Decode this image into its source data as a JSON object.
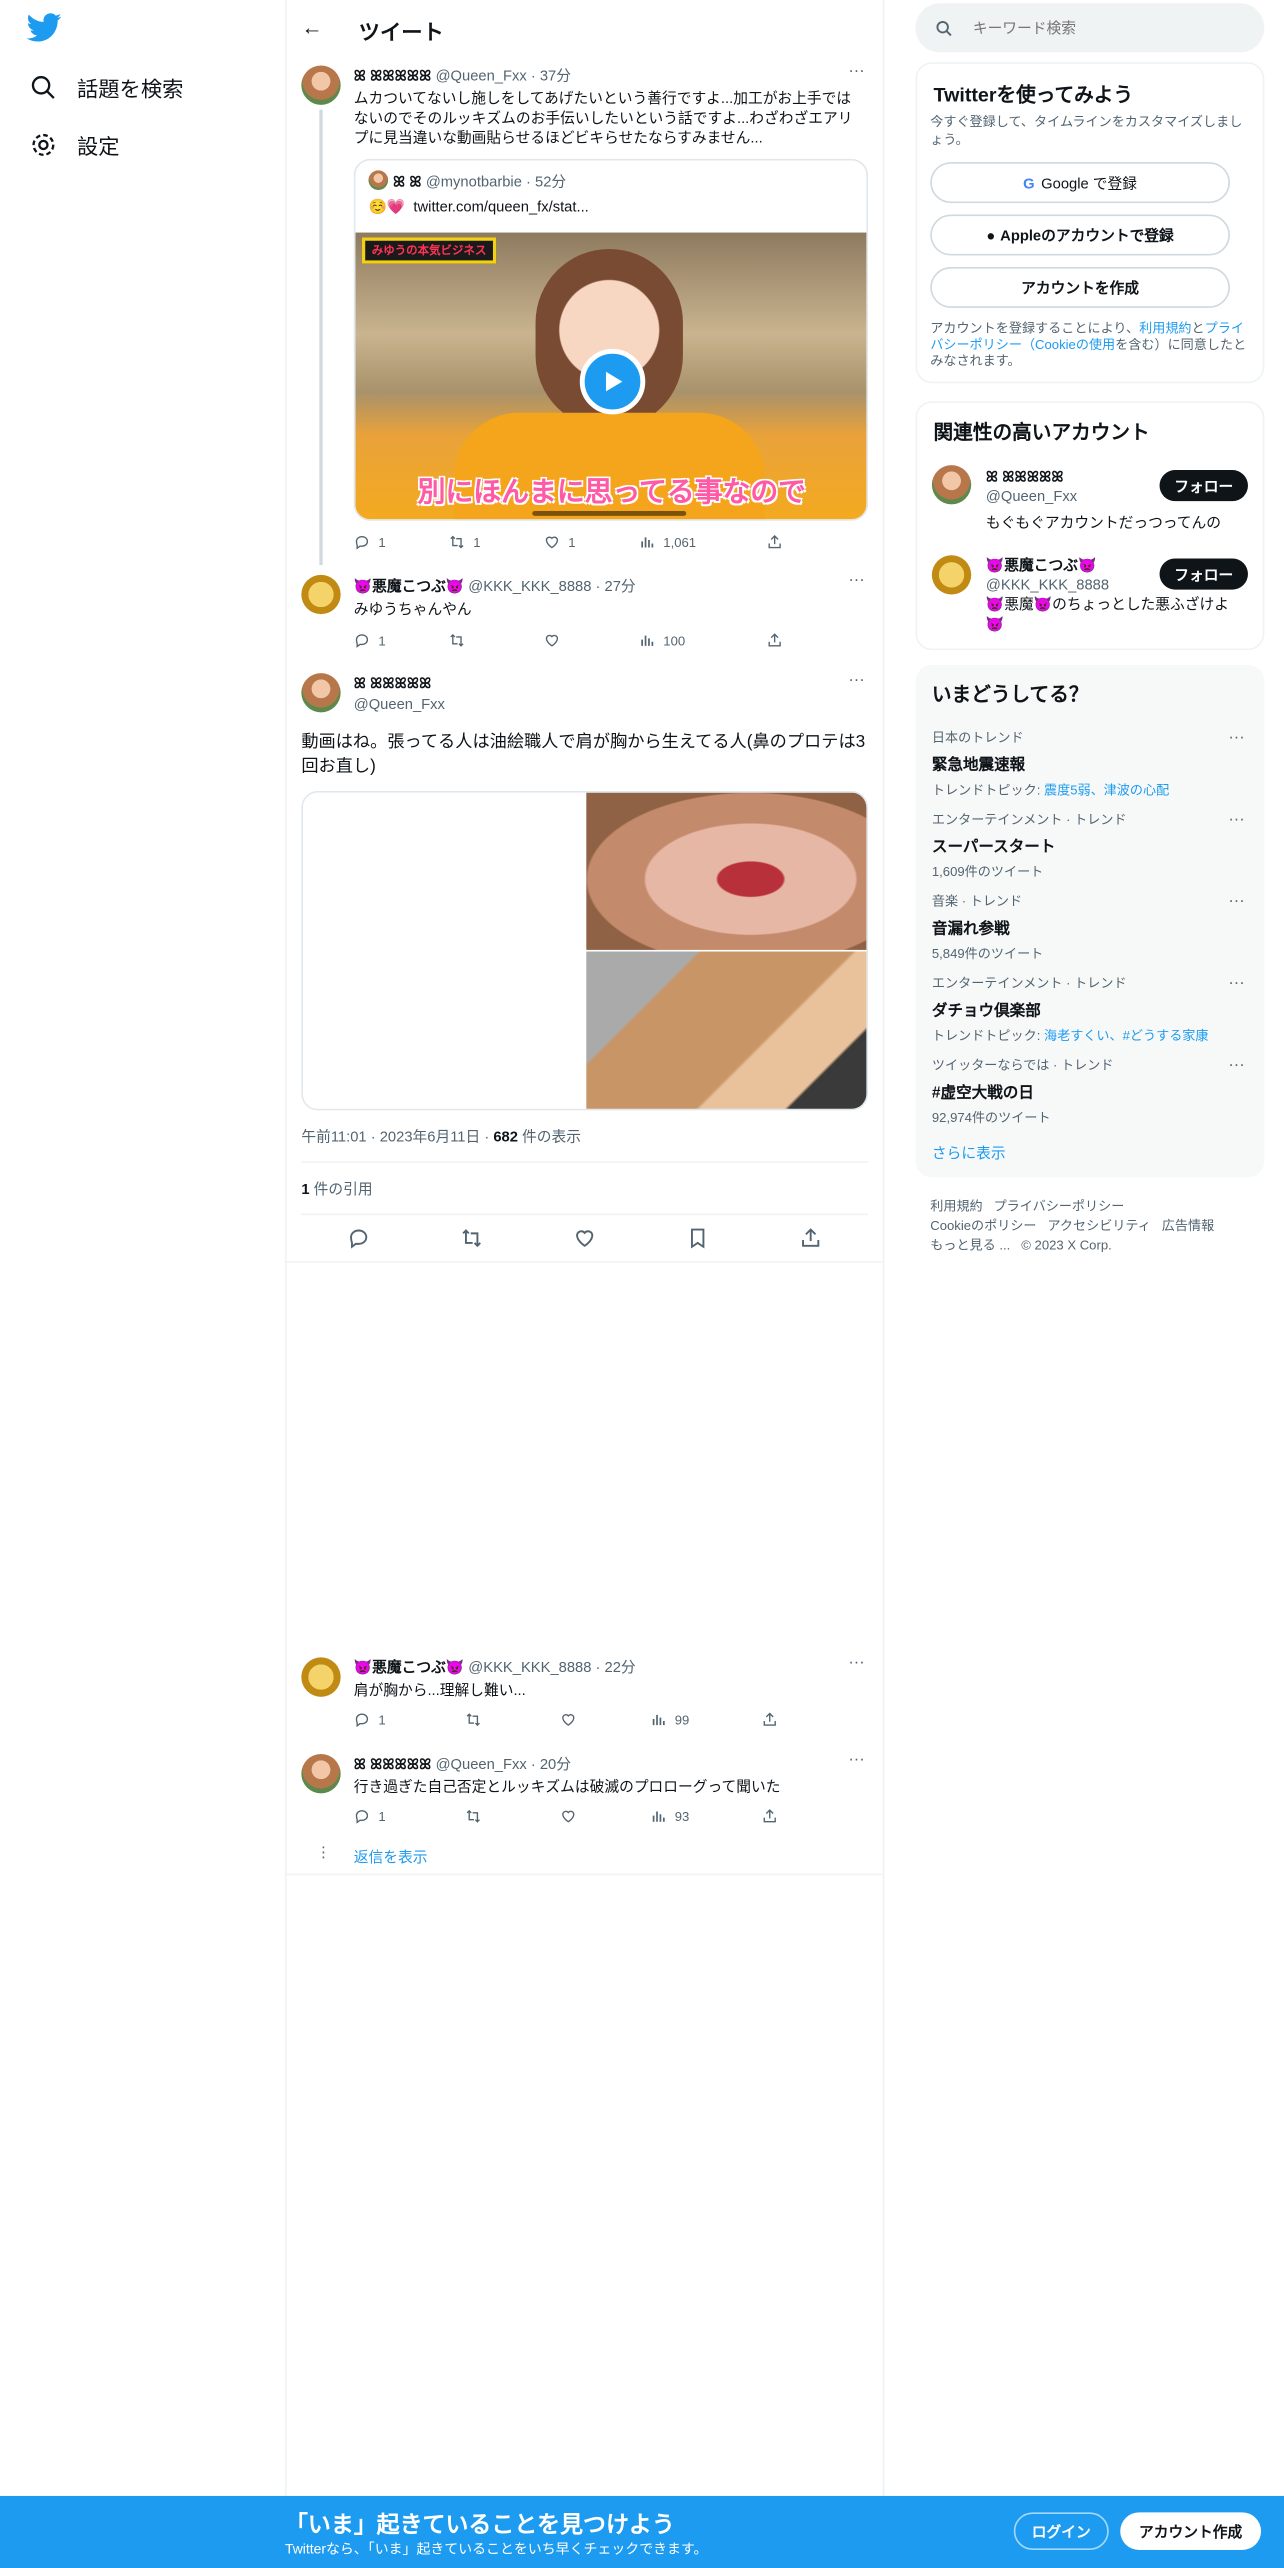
{
  "colors": {
    "accent": "#1d9bf0",
    "text": "#0f1419",
    "muted": "#536471",
    "banner": "#1d9bf0"
  },
  "nav": {
    "logo": "twitter-bird-icon",
    "explore": "話題を検索",
    "settings": "設定"
  },
  "header": {
    "title": "ツイート"
  },
  "reply1": {
    "name": "ꕤ ꕤꕤꕤꕤꕤ",
    "handle": "@Queen_Fxx",
    "time": "37分",
    "text": "ムカついてないし施しをしてあげたいという善行ですよ...加工がお上手ではないのでそのルッキズムのお手伝いしたいという話ですよ...わざわざエアリプに見当違いな動画貼らせるほどビキらせたならすみません...",
    "quote": {
      "name": "ꕤ ꕤ",
      "handle": "@mynotbarbie",
      "time": "52分",
      "text": "twitter.com/queen_fx/stat...",
      "emoji": "☺️💗",
      "caption": "別にほんまに思ってる事なので",
      "sign": "みゆうの本気ビジネス"
    },
    "stats": {
      "replies": "1",
      "retweets": "1",
      "likes": "1",
      "views": "1,061"
    }
  },
  "reply2": {
    "name": "👿悪魔こつぶ👿",
    "handle": "@KKK_KKK_8888",
    "time": "27分",
    "text": "みゆうちゃんやん",
    "stats": {
      "replies": "1",
      "views": "100"
    }
  },
  "main": {
    "name": "ꕤ ꕤꕤꕤꕤꕤ",
    "handle": "@Queen_Fxx",
    "text": "動画はね。張ってる人は油絵職人で肩が胸から生えてる人(鼻のプロテは3回お直し)",
    "time": "午前11:01",
    "date": "2023年6月11日",
    "views_count": "682",
    "views_label": " 件の表示",
    "quotes_count": "1",
    "quotes_label": " 件の引用"
  },
  "reply3": {
    "name": "👿悪魔こつぶ👿",
    "handle": "@KKK_KKK_8888",
    "time": "22分",
    "text": "肩が胸から...理解し難い...",
    "stats": {
      "replies": "1",
      "views": "99"
    }
  },
  "reply4": {
    "name": "ꕤ ꕤꕤꕤꕤꕤ",
    "handle": "@Queen_Fxx",
    "time": "20分",
    "text": "行き過ぎた自己否定とルッキズムは破滅のプロローグって聞いた",
    "stats": {
      "replies": "1",
      "views": "93"
    },
    "show_replies": "返信を表示"
  },
  "sidebar": {
    "search_placeholder": "キーワード検索",
    "signup": {
      "title": "Twitterを使ってみよう",
      "sub": "今すぐ登録して、タイムラインをカスタマイズしましょう。",
      "google": "Google で登録",
      "apple": "Appleのアカウントで登録",
      "create": "アカウントを作成",
      "legal1": "アカウントを登録することにより、",
      "terms": "利用規約",
      "legal2": "と",
      "privacy": "プライバシーポリシー",
      "cookie": "（Cookieの使用",
      "legal3": "を含む）に同意したとみなされます。"
    },
    "relevant": {
      "title": "関連性の高いアカウント",
      "follow": "フォロー",
      "accounts": [
        {
          "name": "ꕤ ꕤꕤꕤꕤꕤ",
          "handle": "@Queen_Fxx",
          "bio": "もぐもぐアカウントだっつってんの"
        },
        {
          "name": "👿悪魔こつぶ👿",
          "handle": "@KKK_KKK_8888",
          "bio": "👿悪魔👿のちょっとした悪ふざけよ👿"
        }
      ]
    },
    "trends": {
      "title": "いまどうしてる？",
      "items": [
        {
          "category": "日本のトレンド",
          "name": "緊急地震速報",
          "sub": "トレンドトピック: ",
          "links": "震度5弱、津波の心配"
        },
        {
          "category": "エンターテインメント · トレンド",
          "name": "スーパースタート",
          "sub": "1,609件のツイート",
          "links": ""
        },
        {
          "category": "音楽 · トレンド",
          "name": "音漏れ参戦",
          "sub": "5,849件のツイート",
          "links": ""
        },
        {
          "category": "エンターテインメント · トレンド",
          "name": "ダチョウ倶楽部",
          "sub": "トレンドトピック: ",
          "links": "海老すくい、#どうする家康"
        },
        {
          "category": "ツイッターならでは · トレンド",
          "name": "#虚空大戦の日",
          "sub": "92,974件のツイート",
          "links": ""
        }
      ],
      "more": "さらに表示"
    },
    "footer": {
      "l1": "利用規約",
      "l2": "プライバシーポリシー",
      "l3": "Cookieのポリシー",
      "l4": "アクセシビリティ",
      "l5": "広告情報",
      "l6": "もっと見る ...",
      "copy": "© 2023 X Corp."
    }
  },
  "banner": {
    "title": "「いま」起きていることを見つけよう",
    "sub": "Twitterなら、「いま」起きていることをいち早くチェックできます。",
    "login": "ログイン",
    "signup": "アカウント作成"
  }
}
